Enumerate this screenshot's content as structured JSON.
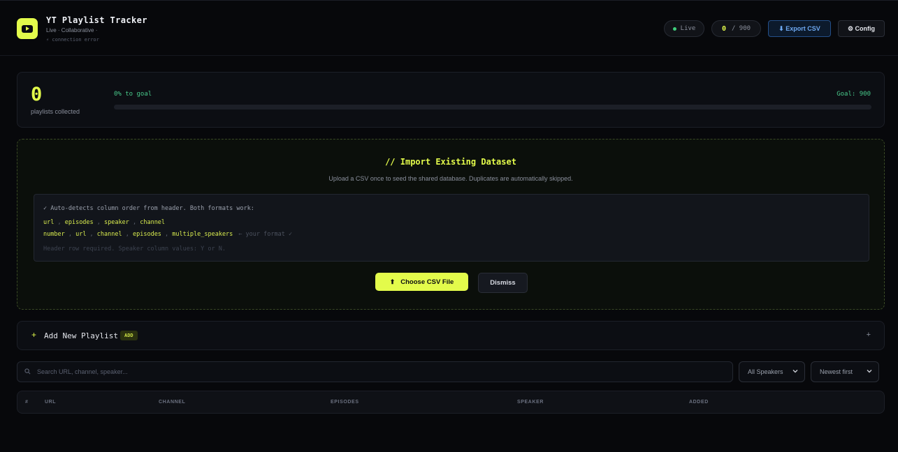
{
  "header": {
    "title": "YT Playlist Tracker",
    "subtitle": "Live · Collaborative ·",
    "status_line": "⚡ connection error",
    "live_label": "Live",
    "count_current": "0",
    "count_goal": "/ 900",
    "export_label": "⬇ Export CSV",
    "config_label": "⚙ Config"
  },
  "stats": {
    "collected": "0",
    "collected_label": "playlists collected",
    "progress_label": "0% to goal",
    "goal_label": "Goal: 900",
    "progress_fraction": 0
  },
  "import": {
    "title": "// Import Existing Dataset",
    "description": "Upload a CSV once to seed the shared database. Duplicates are automatically skipped.",
    "detect_note": "✓ Auto-detects column order from header. Both formats work:",
    "format_a": [
      "url",
      "episodes",
      "speaker",
      "channel"
    ],
    "format_b": [
      "number",
      "url",
      "channel",
      "episodes",
      "multiple_speakers"
    ],
    "format_b_hint": "← your format ✓",
    "footnote": "Header row required. Speaker column values: Y or N.",
    "choose_label": "Choose CSV File",
    "dismiss_label": "Dismiss"
  },
  "add_playlist": {
    "label": "Add New Playlist",
    "badge": "ADD",
    "toggle": "+"
  },
  "filters": {
    "search_placeholder": "Search URL, channel, speaker...",
    "speaker_filter": "All Speakers",
    "sort": "Newest first"
  },
  "table": {
    "columns": [
      "#",
      "URL",
      "CHANNEL",
      "EPISODES",
      "SPEAKER",
      "ADDED"
    ]
  },
  "colors": {
    "accent": "#e3fb4b",
    "success": "#48c98a",
    "link": "#6ea9f2",
    "background": "#07080b"
  }
}
